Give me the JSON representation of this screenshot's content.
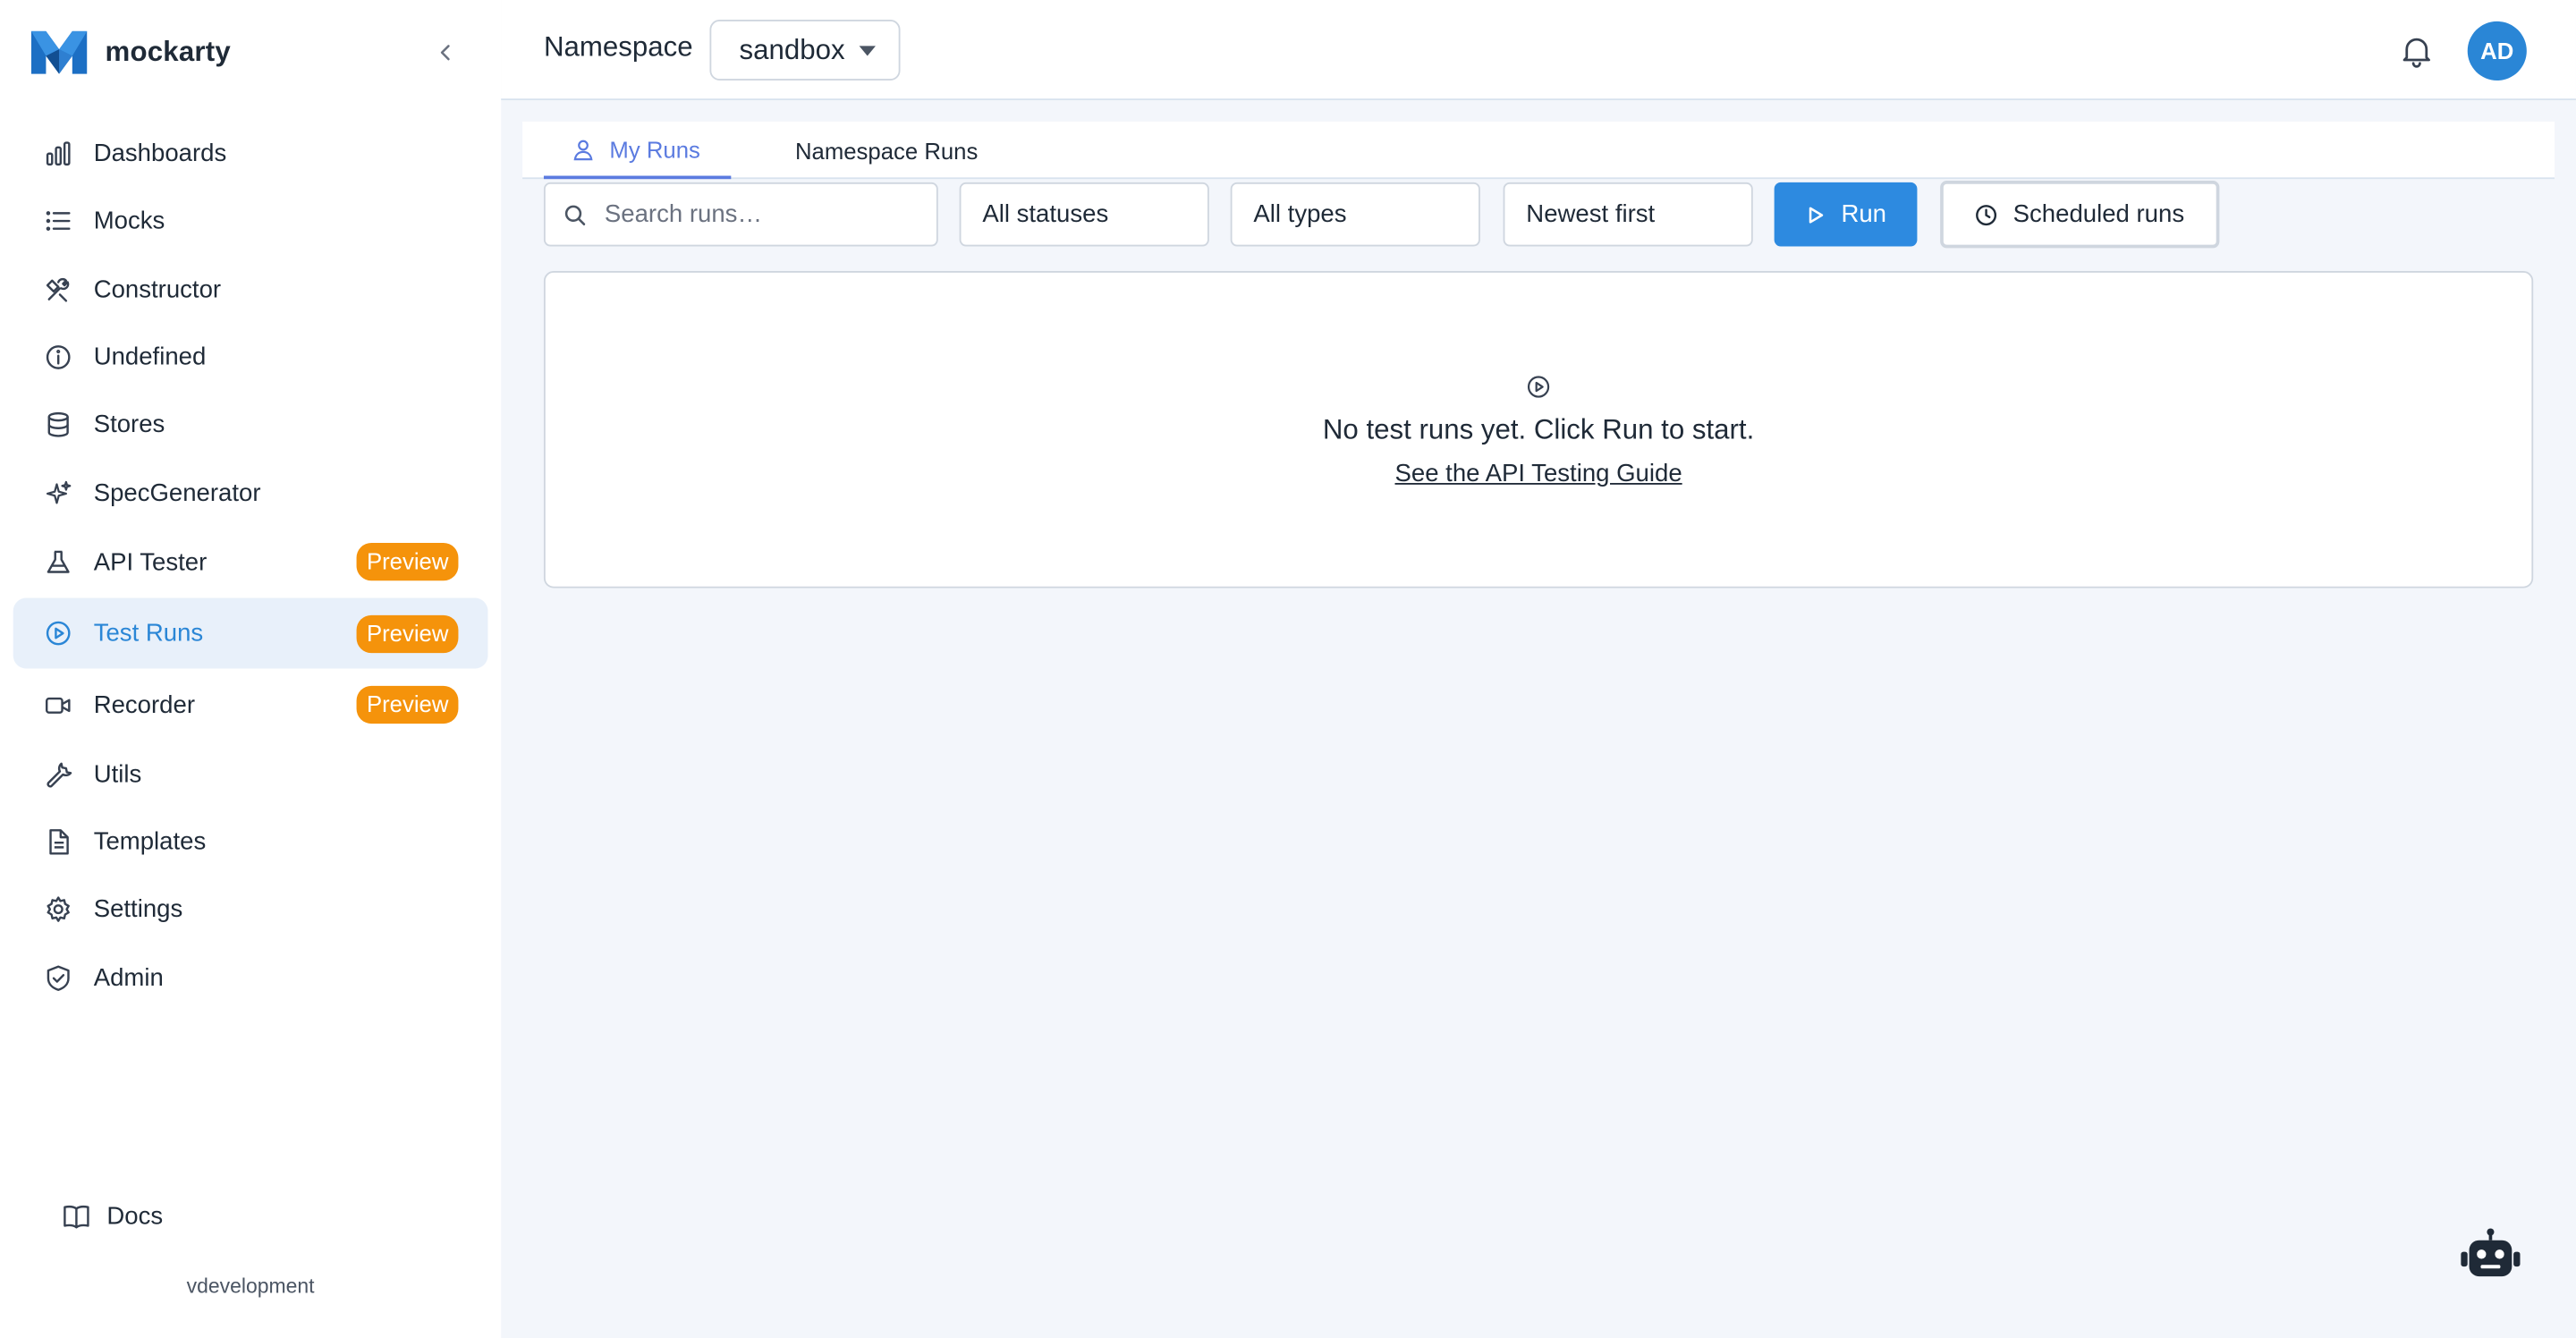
{
  "app": {
    "name": "mockarty"
  },
  "sidebar": {
    "items": [
      {
        "label": "Dashboards",
        "icon": "bar-chart-icon"
      },
      {
        "label": "Mocks",
        "icon": "list-icon"
      },
      {
        "label": "Constructor",
        "icon": "tools-icon"
      },
      {
        "label": "Undefined",
        "icon": "info-icon"
      },
      {
        "label": "Stores",
        "icon": "database-icon"
      },
      {
        "label": "SpecGenerator",
        "icon": "sparkles-icon"
      },
      {
        "label": "API Tester",
        "icon": "flask-icon",
        "badge": "Preview"
      },
      {
        "label": "Test Runs",
        "icon": "play-circle-icon",
        "badge": "Preview",
        "active": true
      },
      {
        "label": "Recorder",
        "icon": "video-icon",
        "badge": "Preview"
      },
      {
        "label": "Utils",
        "icon": "wrench-icon"
      },
      {
        "label": "Templates",
        "icon": "file-icon"
      },
      {
        "label": "Settings",
        "icon": "gear-icon"
      },
      {
        "label": "Admin",
        "icon": "shield-icon"
      }
    ],
    "docs_label": "Docs",
    "environment": "vdevelopment"
  },
  "header": {
    "namespace_label": "Namespace",
    "namespace_value": "sandbox",
    "avatar_initials": "AD"
  },
  "tabs": [
    {
      "label": "My Runs",
      "active": true
    },
    {
      "label": "Namespace Runs",
      "active": false
    }
  ],
  "filters": {
    "search_placeholder": "Search runs…",
    "status": "All statuses",
    "type": "All types",
    "sort": "Newest first",
    "run_label": "Run",
    "scheduled_label": "Scheduled runs"
  },
  "empty_state": {
    "message": "No test runs yet. Click Run to start.",
    "link": "See the API Testing Guide"
  },
  "colors": {
    "accent": "#2d8ae0",
    "active_bg": "#e8f0fa",
    "badge": "#f5930b",
    "tab_active": "#5b7be0",
    "page_bg": "#f3f6fb"
  }
}
